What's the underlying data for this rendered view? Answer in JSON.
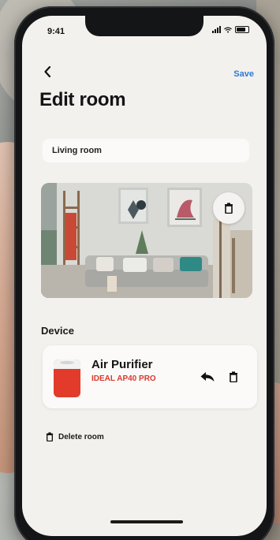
{
  "status_bar": {
    "time": "9:41"
  },
  "header": {
    "back_icon": "chevron-left-icon",
    "save_label": "Save",
    "title": "Edit room"
  },
  "room_name_field": {
    "value": "Living room"
  },
  "room_photo": {
    "delete_icon": "trash-icon"
  },
  "device_section": {
    "heading": "Device",
    "devices": [
      {
        "name": "Air Purifier",
        "model": "IDEAL AP40 PRO",
        "reassign_icon": "reply-arrow-icon",
        "delete_icon": "trash-icon"
      }
    ]
  },
  "delete_room": {
    "label": "Delete room",
    "icon": "trash-icon"
  },
  "colors": {
    "accent": "#2e7ad4",
    "model_text": "#d83a2e",
    "screen_bg": "#f3f1ee",
    "card_bg": "#fbfaf8"
  }
}
